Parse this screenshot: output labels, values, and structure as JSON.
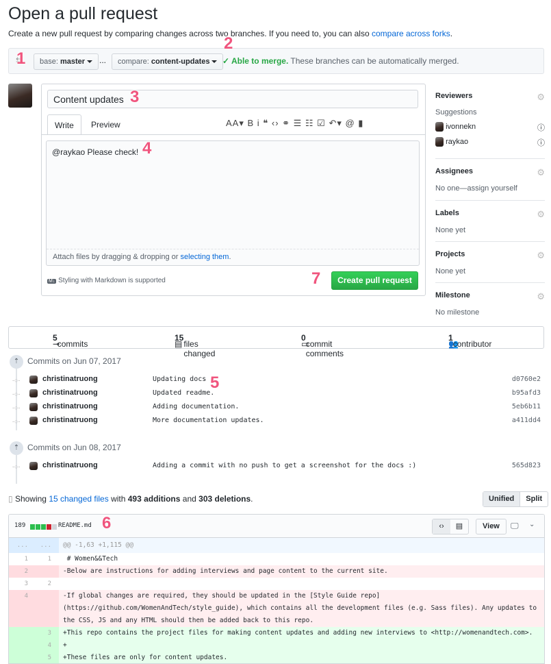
{
  "page": {
    "title": "Open a pull request",
    "subtitle": "Create a new pull request by comparing changes across two branches. If you need to, you can also ",
    "subtitle_link": "compare across forks",
    "subtitle_end": "."
  },
  "compare": {
    "base_label": "base:",
    "base_value": "master",
    "ellipsis": "...",
    "compare_label": "compare:",
    "compare_value": "content-updates",
    "merge_status": "✓ Able to merge.",
    "merge_text": " These branches can be automatically merged."
  },
  "form": {
    "title_value": "Content updates",
    "tabs": [
      "Write",
      "Preview"
    ],
    "toolbar": "AA▾ B i   ❝ ‹› ⚭   ☰ ☷ ☑   ↶▾ @ ▮",
    "body": "@raykao Please check!",
    "attach_text": "Attach files by dragging & dropping or ",
    "attach_link": "selecting them",
    "attach_end": ".",
    "markdown_icon": "M↓",
    "markdown_note": "Styling with Markdown is supported",
    "submit": "Create pull request"
  },
  "sidebar": {
    "reviewers": {
      "label": "Reviewers",
      "suggestions": "Suggestions",
      "users": [
        "ivonnekn",
        "raykao"
      ]
    },
    "assignees": {
      "label": "Assignees",
      "value": "No one—assign yourself"
    },
    "labels": {
      "label": "Labels",
      "value": "None yet"
    },
    "projects": {
      "label": "Projects",
      "value": "None yet"
    },
    "milestone": {
      "label": "Milestone",
      "value": "No milestone"
    }
  },
  "stats": {
    "commits_n": "5",
    "commits": " commits",
    "files_n": "15",
    "files": " files changed",
    "comments_n": "0",
    "comments": " commit comments",
    "contrib_n": "1",
    "contrib": " contributor"
  },
  "commit_groups": [
    {
      "date": "Commits on Jun 07, 2017",
      "commits": [
        {
          "author": "christinatruong",
          "message": "Updating docs",
          "sha": "d0760e2"
        },
        {
          "author": "christinatruong",
          "message": "Updated readme.",
          "sha": "b95afd3"
        },
        {
          "author": "christinatruong",
          "message": "Adding documentation.",
          "sha": "5eb6b11"
        },
        {
          "author": "christinatruong",
          "message": "More documentation updates.",
          "sha": "a411dd4"
        }
      ]
    },
    {
      "date": "Commits on Jun 08, 2017",
      "commits": [
        {
          "author": "christinatruong",
          "message": "Adding a commit with no push to get a screenshot for the docs :)",
          "sha": "565d823"
        }
      ]
    }
  ],
  "summary": {
    "showing": "Showing ",
    "files_link": "15 changed files",
    "with": " with ",
    "additions": "493 additions",
    "and": " and ",
    "deletions": "303 deletions",
    "end": ".",
    "unified": "Unified",
    "split": "Split"
  },
  "file": {
    "changes": "189",
    "name": "README.md",
    "view": "View",
    "hunk": "@@ -1,63 +1,115 @@",
    "hunk_dots": "...",
    "lines": [
      {
        "type": "ctx",
        "old": "1",
        "new": "1",
        "text": " # Women&&Tech"
      },
      {
        "type": "del",
        "old": "2",
        "new": "",
        "text": "-Below are instructions for adding interviews and page content to the current site."
      },
      {
        "type": "ctx",
        "old": "3",
        "new": "2",
        "text": " "
      },
      {
        "type": "del",
        "old": "4",
        "new": "",
        "text": "-If global changes are required, they should be updated in the [Style Guide repo](https://github.com/WomenAndTech/style_guide), which contains all the development files (e.g. Sass files). Any updates to the CSS, JS and any HTML should then be added back to this repo."
      },
      {
        "type": "add",
        "old": "",
        "new": "3",
        "text": "+This repo contains the project files for making content updates and adding new interviews to <http://womenandtech.com>."
      },
      {
        "type": "add",
        "old": "",
        "new": "4",
        "text": "+"
      },
      {
        "type": "add",
        "old": "",
        "new": "5",
        "text": "+These files are only for content updates."
      }
    ]
  },
  "annotations": [
    "1",
    "2",
    "3",
    "4",
    "5",
    "6",
    "7"
  ],
  "colors": {
    "link": "#0366d6",
    "green": "#28a745",
    "annotation": "#f0557e"
  }
}
